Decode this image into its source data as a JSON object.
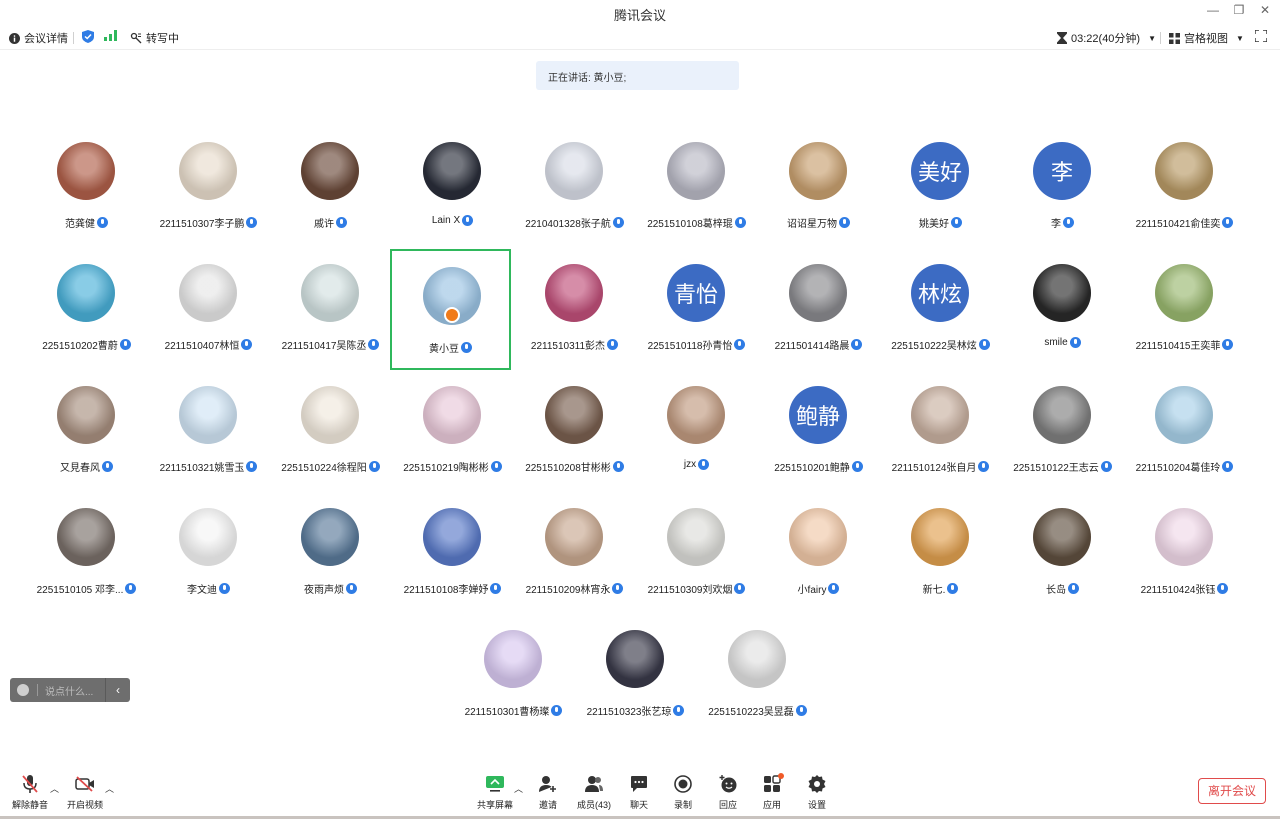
{
  "window": {
    "title": "腾讯会议"
  },
  "toolbar": {
    "meeting_info": "会议详情",
    "transcribing": "转写中",
    "timer": "03:22(40分钟)",
    "view_mode": "宫格视图"
  },
  "speaking_banner": "正在讲话: 黄小豆;",
  "participants": [
    {
      "name": "范龚健",
      "avatar_text": "",
      "color": "#b0604a"
    },
    {
      "name": "2211510307李子鹏",
      "avatar_text": "",
      "color": "#e8dccc"
    },
    {
      "name": "戚许",
      "avatar_text": "",
      "color": "#6b4a3a"
    },
    {
      "name": "Lain X",
      "avatar_text": "",
      "color": "#2a2e3a"
    },
    {
      "name": "2210401328张子航",
      "avatar_text": "",
      "color": "#d8dce6"
    },
    {
      "name": "2251510108葛梓琨",
      "avatar_text": "",
      "color": "#b8b8c4"
    },
    {
      "name": "诏诏星万物",
      "avatar_text": "",
      "color": "#c8a070"
    },
    {
      "name": "姚美好",
      "avatar_text": "美好",
      "color": "#3c6bc3"
    },
    {
      "name": "李",
      "avatar_text": "李",
      "color": "#3c6bc3"
    },
    {
      "name": "2211510421俞佳奕",
      "avatar_text": "",
      "color": "#b89a66"
    },
    {
      "name": "2251510202曹蔚",
      "avatar_text": "",
      "color": "#4ab0d8"
    },
    {
      "name": "2211510407林恒",
      "avatar_text": "",
      "color": "#e6e6e6"
    },
    {
      "name": "2211510417吴陈丞",
      "avatar_text": "",
      "color": "#d2e0e0"
    },
    {
      "name": "黄小豆",
      "avatar_text": "",
      "color": "#9cc4e4"
    },
    {
      "name": "2211510311彭杰",
      "avatar_text": "",
      "color": "#c0507a"
    },
    {
      "name": "2251510118孙青怡",
      "avatar_text": "青怡",
      "color": "#3c6bc3"
    },
    {
      "name": "2211501414路晨",
      "avatar_text": "",
      "color": "#8a8a8e"
    },
    {
      "name": "2251510222吴林炫",
      "avatar_text": "林炫",
      "color": "#3c6bc3"
    },
    {
      "name": "smile",
      "avatar_text": "",
      "color": "#2a2a2a"
    },
    {
      "name": "2211510415王奕菲",
      "avatar_text": "",
      "color": "#9ab870"
    },
    {
      "name": "又見春风",
      "avatar_text": "",
      "color": "#a89080"
    },
    {
      "name": "2211510321姚雪玉",
      "avatar_text": "",
      "color": "#d0e4f4"
    },
    {
      "name": "2251510224徐程阳",
      "avatar_text": "",
      "color": "#f0e8dc"
    },
    {
      "name": "2251510219陶彬彬",
      "avatar_text": "",
      "color": "#e8c8d8"
    },
    {
      "name": "2251510208甘彬彬",
      "avatar_text": "",
      "color": "#7a6050"
    },
    {
      "name": "jzx",
      "avatar_text": "",
      "color": "#c09a80"
    },
    {
      "name": "2251510201鲍静",
      "avatar_text": "鲍静",
      "color": "#3c6bc3"
    },
    {
      "name": "2211510124张自月",
      "avatar_text": "",
      "color": "#c8b0a0"
    },
    {
      "name": "2251510122王志云",
      "avatar_text": "",
      "color": "#808080"
    },
    {
      "name": "2211510204葛佳玲",
      "avatar_text": "",
      "color": "#a8d0e8"
    },
    {
      "name": "2251510105 邓李...",
      "avatar_text": "",
      "color": "#7a706a"
    },
    {
      "name": "李文迪",
      "avatar_text": "",
      "color": "#f4f4f4"
    },
    {
      "name": "夜雨声烦",
      "avatar_text": "",
      "color": "#5a7a9a"
    },
    {
      "name": "2211510108李婵妤",
      "avatar_text": "",
      "color": "#5a7ac8"
    },
    {
      "name": "2211510209林宵永",
      "avatar_text": "",
      "color": "#c8a890"
    },
    {
      "name": "2211510309刘欢烟",
      "avatar_text": "",
      "color": "#dcdcd8"
    },
    {
      "name": "小fairy",
      "avatar_text": "",
      "color": "#f0c8a8"
    },
    {
      "name": "新七.",
      "avatar_text": "",
      "color": "#e0a050"
    },
    {
      "name": "长岛",
      "avatar_text": "",
      "color": "#605040"
    },
    {
      "name": "2211510424张钰",
      "avatar_text": "",
      "color": "#f0d8e8"
    },
    {
      "name": "2211510301曹杨璨",
      "avatar_text": "",
      "color": "#d8c8f0"
    },
    {
      "name": "2211510323张艺琼",
      "avatar_text": "",
      "color": "#3a3a4a"
    },
    {
      "name": "2251510223吴昱磊",
      "avatar_text": "",
      "color": "#e0e0e0"
    }
  ],
  "chat_input": {
    "placeholder": "说点什么..."
  },
  "bottom": {
    "unmute": "解除静音",
    "start_video": "开启视频",
    "share_screen": "共享屏幕",
    "invite": "邀请",
    "members": "成员(43)",
    "chat": "聊天",
    "record": "录制",
    "react": "回应",
    "apps": "应用",
    "settings": "设置",
    "leave": "离开会议"
  }
}
